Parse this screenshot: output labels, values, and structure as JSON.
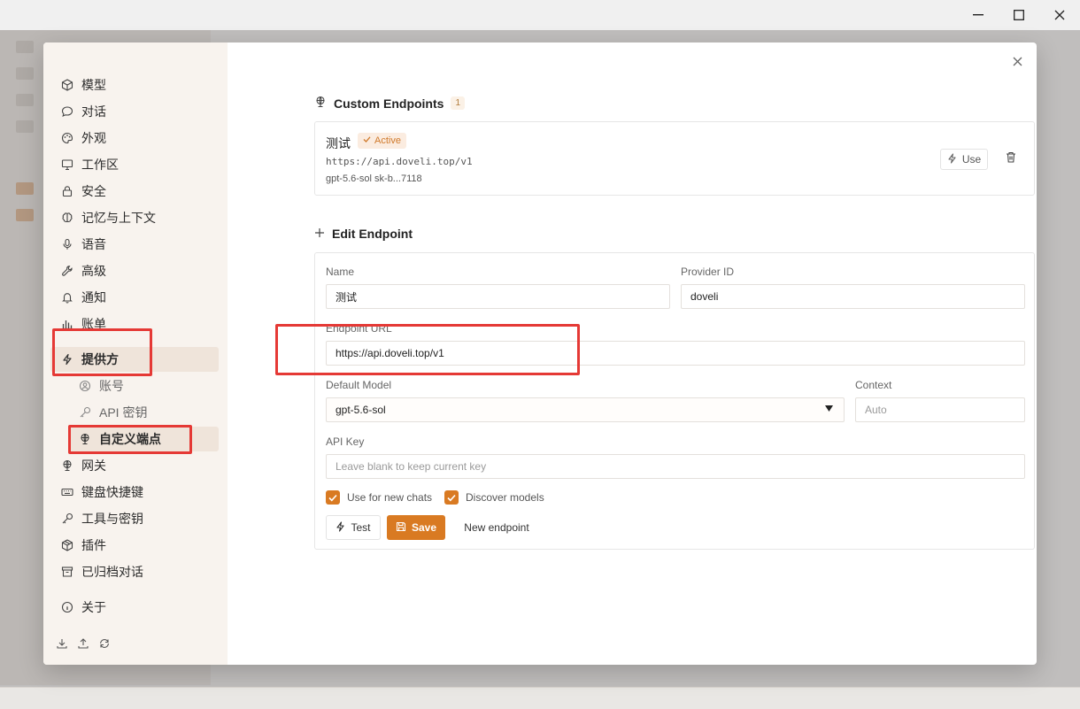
{
  "window": {
    "minimize": "—",
    "maximize": "☐",
    "close": "✕"
  },
  "nav": {
    "items": [
      {
        "label": "模型",
        "icon": "cube-icon"
      },
      {
        "label": "对话",
        "icon": "chat-bubble-icon"
      },
      {
        "label": "外观",
        "icon": "palette-icon"
      },
      {
        "label": "工作区",
        "icon": "monitor-icon"
      },
      {
        "label": "安全",
        "icon": "lock-icon"
      },
      {
        "label": "记忆与上下文",
        "icon": "brain-icon"
      },
      {
        "label": "语音",
        "icon": "microphone-icon"
      },
      {
        "label": "高级",
        "icon": "wrench-icon"
      },
      {
        "label": "通知",
        "icon": "bell-icon"
      },
      {
        "label": "账单",
        "icon": "bar-chart-icon"
      },
      {
        "label": "提供方",
        "icon": "lightning-icon"
      },
      {
        "label": "账号",
        "icon": "user-circle-icon"
      },
      {
        "label": "API 密钥",
        "icon": "key-icon"
      },
      {
        "label": "自定义端点",
        "icon": "globe-icon"
      },
      {
        "label": "网关",
        "icon": "globe-icon"
      },
      {
        "label": "键盘快捷键",
        "icon": "keyboard-icon"
      },
      {
        "label": "工具与密钥",
        "icon": "key-icon"
      },
      {
        "label": "插件",
        "icon": "package-icon"
      },
      {
        "label": "已归档对话",
        "icon": "archive-icon"
      },
      {
        "label": "关于",
        "icon": "info-icon"
      }
    ]
  },
  "custom_endpoints": {
    "title": "Custom Endpoints",
    "count": "1",
    "endpoint": {
      "name": "测试",
      "status": "Active",
      "url": "https://api.doveli.top/v1",
      "meta": "gpt-5.6-sol  sk-b...7118",
      "use_label": "Use"
    }
  },
  "edit_endpoint": {
    "title": "Edit Endpoint",
    "name_label": "Name",
    "name_value": "测试",
    "provider_label": "Provider ID",
    "provider_value": "doveli",
    "url_label": "Endpoint URL",
    "url_value": "https://api.doveli.top/v1",
    "model_label": "Default Model",
    "model_value": "gpt-5.6-sol",
    "context_label": "Context",
    "context_placeholder": "Auto",
    "apikey_label": "API Key",
    "apikey_placeholder": "Leave blank to keep current key",
    "use_new_chats": "Use for new chats",
    "discover_models": "Discover models",
    "test_label": "Test",
    "save_label": "Save",
    "new_endpoint_label": "New endpoint"
  },
  "colors": {
    "accent": "#d97a22",
    "highlight": "#e53935",
    "nav_bg": "#f8f3ee",
    "nav_active": "#efe4da"
  }
}
